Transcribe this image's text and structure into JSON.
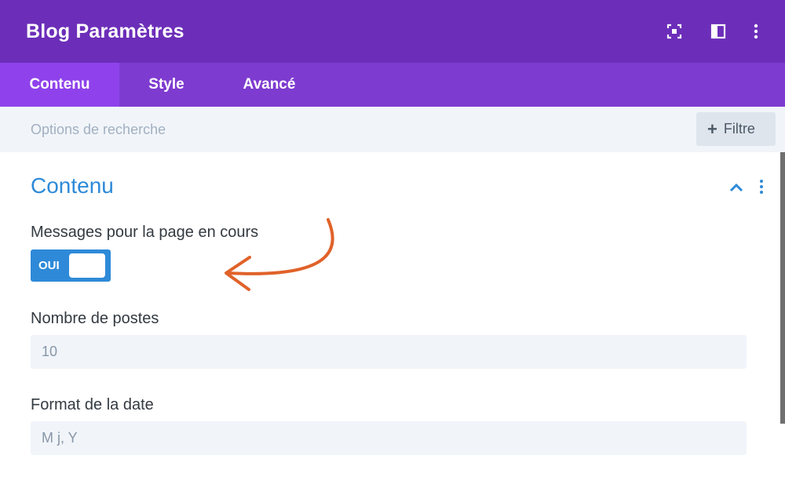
{
  "header": {
    "title": "Blog Paramètres",
    "icons": [
      "fullscreen-icon",
      "split-view-icon",
      "more-options-icon"
    ]
  },
  "tabs": [
    {
      "label": "Contenu",
      "active": true
    },
    {
      "label": "Style",
      "active": false
    },
    {
      "label": "Avancé",
      "active": false
    }
  ],
  "search": {
    "placeholder": "Options de recherche",
    "filter_label": "Filtre"
  },
  "section": {
    "title": "Contenu",
    "icons": [
      "chevron-up-icon",
      "more-options-icon"
    ]
  },
  "fields": {
    "current_page": {
      "label": "Messages pour la page en cours",
      "toggle_text": "OUI",
      "value": true
    },
    "post_count": {
      "label": "Nombre de postes",
      "placeholder": "10"
    },
    "date_format": {
      "label": "Format de la date",
      "placeholder": "M j, Y"
    }
  },
  "colors": {
    "header_bg": "#6c2eb9",
    "tabs_bg": "#7e3bd0",
    "active_tab_bg": "#8f42ec",
    "accent_blue": "#2e8ad8",
    "annotation_arrow": "#e0622a"
  }
}
